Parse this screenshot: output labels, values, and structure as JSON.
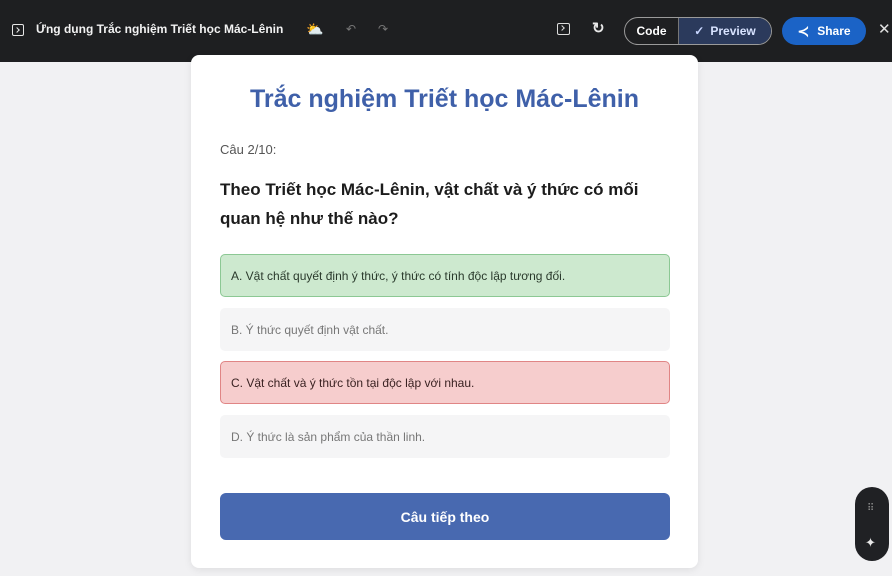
{
  "topbar": {
    "app_title": "Ứng dụng Trắc nghiệm Triết học Mác-Lênin",
    "cloud_icon": "⛅",
    "undo_icon": "↶",
    "redo_icon": "↷",
    "refresh_icon": "↻",
    "code_label": "Code",
    "preview_check": "✓",
    "preview_label": "Preview",
    "share_icon": "≺",
    "share_label": "Share",
    "close_icon": "✕"
  },
  "quiz": {
    "title": "Trắc nghiệm Triết học Mác-Lênin",
    "counter": "Câu 2/10:",
    "question": "Theo Triết học Mác-Lênin, vật chất và ý thức có mối quan hệ như thế nào?",
    "options": [
      {
        "label": "A. Vật chất quyết định ý thức, ý thức có tính độc lập tương đối.",
        "state": "correct"
      },
      {
        "label": "B. Ý thức quyết định vật chất.",
        "state": "neutral"
      },
      {
        "label": "C. Vật chất và ý thức tồn tại độc lập với nhau.",
        "state": "wrong"
      },
      {
        "label": "D. Ý thức là sản phẩm của thần linh.",
        "state": "neutral"
      }
    ],
    "next_label": "Câu tiếp theo"
  },
  "floating_widget": {
    "grid_icon": "⠿",
    "sparkle_icon": "✦"
  },
  "colors": {
    "title_blue": "#3f60a9",
    "correct_bg": "#cde9cf",
    "wrong_bg": "#f6cdcd",
    "button_blue": "#4869b0",
    "share_blue": "#1b63c6"
  }
}
